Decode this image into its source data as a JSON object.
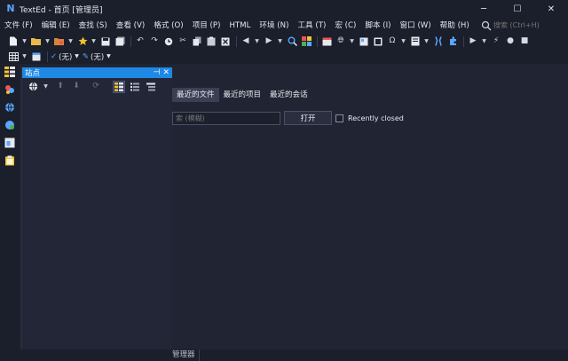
{
  "window": {
    "app_logo": "N",
    "title": "TextEd - 首页 [管理员]",
    "minimize": "─",
    "maximize": "☐",
    "close": "✕"
  },
  "menu": {
    "items": [
      "文件 (F)",
      "编辑 (E)",
      "查找 (S)",
      "查看 (V)",
      "格式 (O)",
      "项目 (P)",
      "HTML",
      "环境 (N)",
      "工具 (T)",
      "宏 (C)",
      "脚本 (I)",
      "窗口 (W)",
      "帮助 (H)"
    ],
    "search_placeholder": "搜索 (Ctrl+H)"
  },
  "toolbar2": {
    "combo1": "(无)",
    "combo2": "(无)"
  },
  "sites_panel": {
    "title": "站点",
    "pin": "⊣",
    "close": "✕"
  },
  "start_page": {
    "tabs": [
      "最近的文件",
      "最近的项目",
      "最近的会话"
    ],
    "filter_placeholder": "索 (模糊)",
    "open_button": "打开",
    "recently_closed": "Recently closed"
  },
  "status": {
    "tab_label": "管理器"
  },
  "colors": {
    "accent": "#1e88e5",
    "background": "#212433",
    "chrome": "#1b1e2b"
  }
}
